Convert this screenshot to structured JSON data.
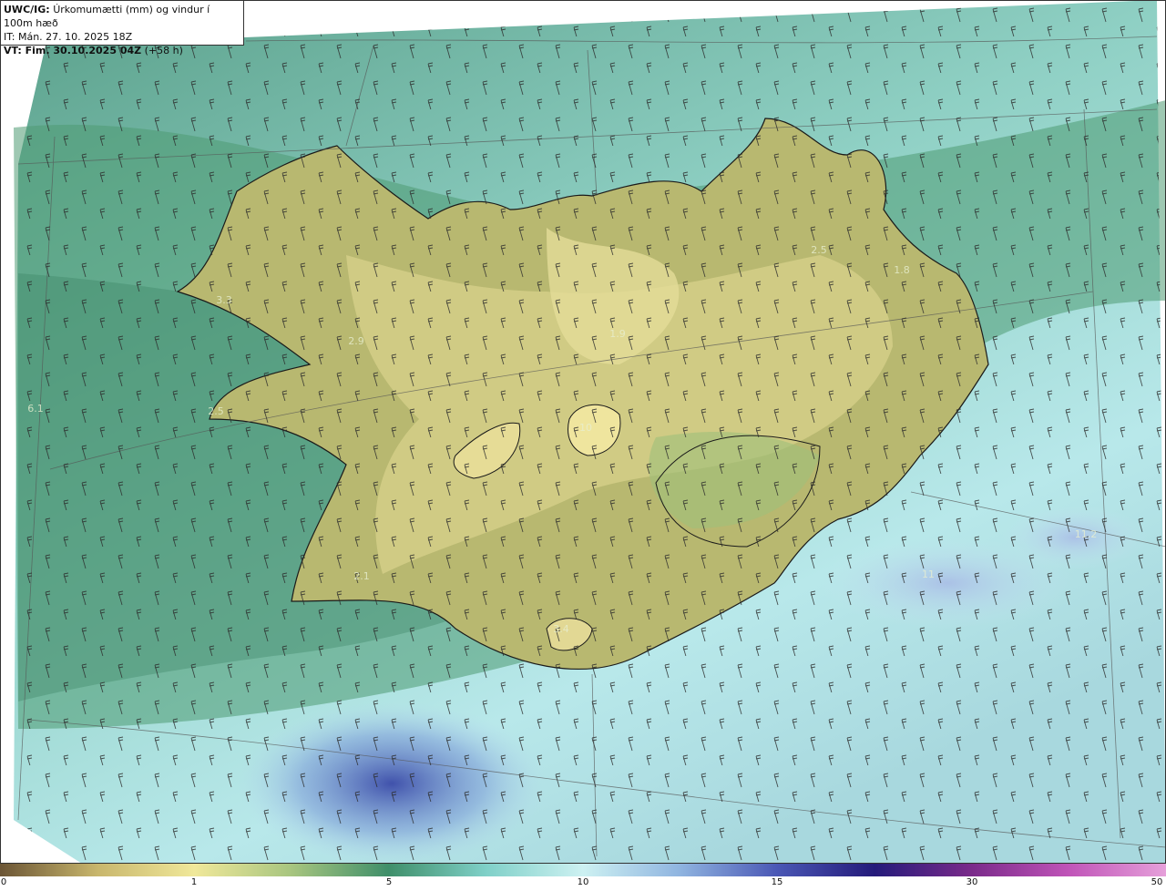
{
  "header": {
    "model": "UWC/IG:",
    "title": "Úrkomumætti (mm) og vindur í 100m hæð",
    "initial_time": "IT: Mán. 27. 10. 2025 18Z",
    "valid_label": "VT: Fim. 30.10.2025 04Z",
    "lead": "(+58 h)"
  },
  "colorbar": {
    "ticks": [
      "0",
      "1",
      "5",
      "10",
      "15",
      "30",
      "50"
    ],
    "colors": [
      "#6b5535",
      "#c8b66c",
      "#f0e89a",
      "#a7c57f",
      "#3f8f6a",
      "#7fd0c8",
      "#cdf1f2",
      "#8fb4e0",
      "#4a57b5",
      "#241a7a",
      "#7a2a8a",
      "#c054b8",
      "#e6a0da"
    ]
  },
  "map_values": [
    "3.3",
    "2.9",
    "6.1",
    "2.5",
    "2.5",
    "1.8",
    "10",
    "3.4",
    "2.1",
    "1.9",
    "11",
    "11.2"
  ]
}
